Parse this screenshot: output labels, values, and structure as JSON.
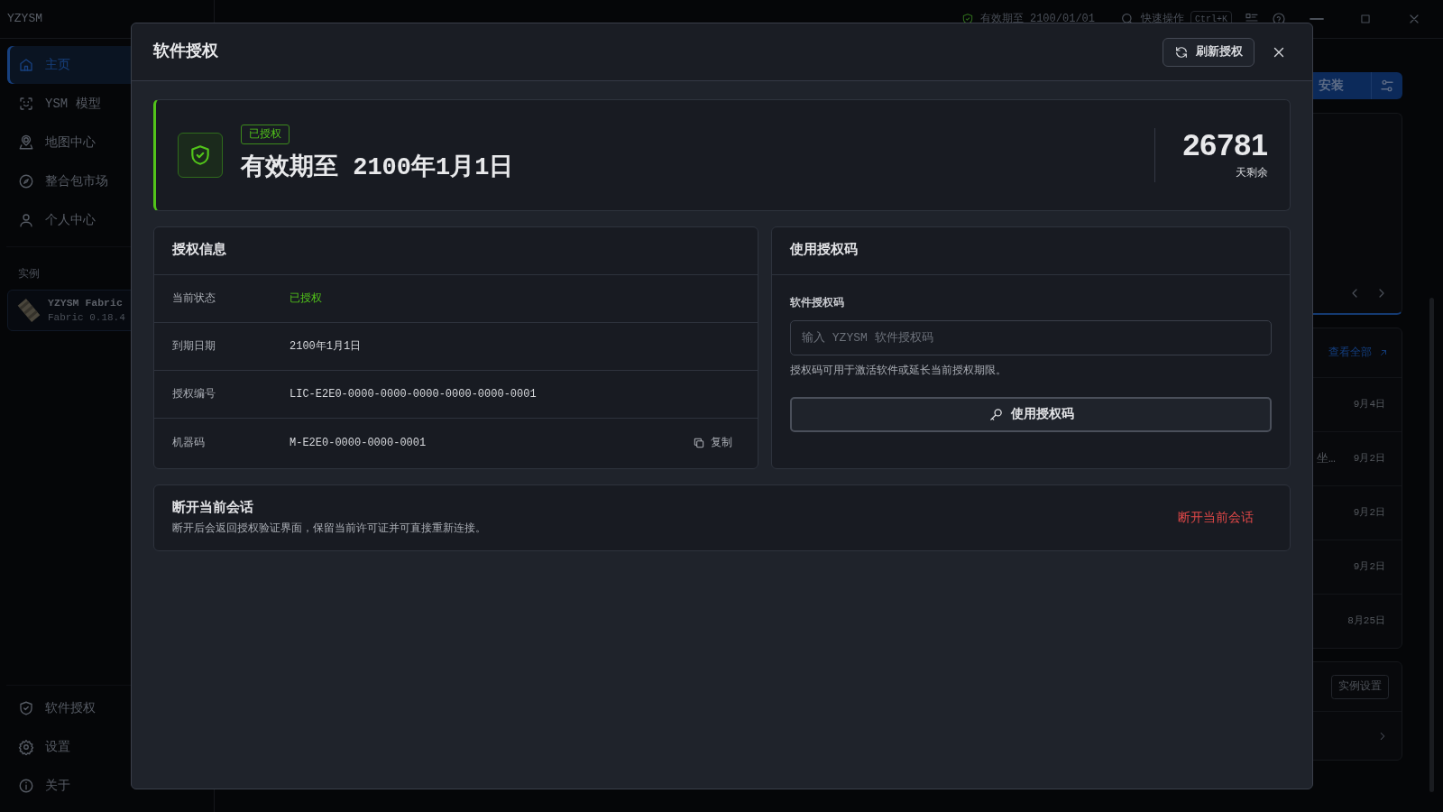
{
  "app": {
    "title": "YZYSM"
  },
  "topbar": {
    "license_text": "有效期至 2100/01/01",
    "quick_action": "快速操作",
    "shortcut": "Ctrl+K"
  },
  "sidebar": {
    "nav": [
      {
        "label": "主页",
        "selected": true
      },
      {
        "label": "YSM 模型",
        "selected": false
      },
      {
        "label": "地图中心",
        "selected": false
      },
      {
        "label": "整合包市场",
        "selected": false
      },
      {
        "label": "个人中心",
        "selected": false
      }
    ],
    "section_label": "实例",
    "instance": {
      "name": "YZYSM Fabric",
      "version": "Fabric 0.18.4"
    },
    "footer": [
      {
        "label": "软件授权",
        "selected": false
      },
      {
        "label": "设置",
        "selected": false
      },
      {
        "label": "关于",
        "selected": false
      }
    ]
  },
  "background": {
    "install_button": "安装",
    "view_all": "查看全部",
    "activity": [
      {
        "date": "9月4日"
      },
      {
        "snippet": "坐…",
        "date": "9月2日"
      },
      {
        "date": "9月2日"
      },
      {
        "date": "9月2日"
      },
      {
        "date": "8月25日"
      }
    ],
    "instance_settings": "实例设置"
  },
  "dialog": {
    "title": "软件授权",
    "refresh_button": "刷新授权",
    "status": {
      "badge": "已授权",
      "headline": "有效期至 2100年1月1日",
      "days": "26781",
      "days_caption": "天剩余"
    },
    "info": {
      "title": "授权信息",
      "rows": [
        {
          "kind": "status",
          "label": "当前状态",
          "value": "已授权"
        },
        {
          "kind": "text",
          "label": "到期日期",
          "value": "2100年1月1日"
        },
        {
          "kind": "text",
          "label": "授权编号",
          "value": "LIC-E2E0-0000-0000-0000-0000-0000-0001"
        },
        {
          "kind": "copy",
          "label": "机器码",
          "value": "M-E2E0-0000-0000-0001",
          "action": "复制"
        }
      ]
    },
    "redeem": {
      "title": "使用授权码",
      "field_label": "软件授权码",
      "placeholder": "输入 YZYSM 软件授权码",
      "help": "授权码可用于激活软件或延长当前授权期限。",
      "button": "使用授权码"
    },
    "session": {
      "title": "断开当前会话",
      "description": "断开后会返回授权验证界面，保留当前许可证并可直接重新连接。",
      "button": "断开当前会话"
    }
  }
}
